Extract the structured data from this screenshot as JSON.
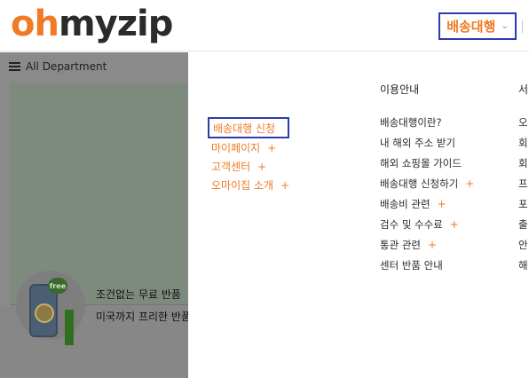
{
  "header": {
    "logo_oh": "oh",
    "logo_rest": "myzip",
    "service_label": "배송대행",
    "service_chevron": "⌄"
  },
  "left": {
    "dept_label": "All Department",
    "promo": {
      "tag": "free",
      "title": "조건없는 무료 반품",
      "subtitle": "미국까지 프리한 반품"
    }
  },
  "menu": {
    "sub_items": [
      {
        "label": "배송대행 신청",
        "plus": ""
      },
      {
        "label": "마이페이지",
        "plus": "+"
      },
      {
        "label": "고객센터",
        "plus": "+"
      },
      {
        "label": "오마이집 소개",
        "plus": "+"
      }
    ],
    "columns": [
      {
        "heading": "이용안내",
        "links": [
          {
            "label": "배송대행이란?",
            "plus": ""
          },
          {
            "label": "내 해외 주소 받기",
            "plus": ""
          },
          {
            "label": "해외 쇼핑몰 가이드",
            "plus": ""
          },
          {
            "label": "배송대행 신청하기",
            "plus": "+"
          },
          {
            "label": "배송비 관련",
            "plus": "+"
          },
          {
            "label": "검수 및 수수료",
            "plus": "+"
          },
          {
            "label": "통관 관련",
            "plus": "+"
          },
          {
            "label": "센터 반품 안내",
            "plus": ""
          }
        ]
      },
      {
        "heading": "서",
        "links": [
          {
            "label": "오"
          },
          {
            "label": "회"
          },
          {
            "label": "회"
          },
          {
            "label": "프"
          },
          {
            "label": "포"
          },
          {
            "label": "출"
          },
          {
            "label": "안"
          },
          {
            "label": "해"
          }
        ]
      }
    ]
  },
  "colors": {
    "brand_orange": "#ef7a22",
    "highlight_border": "#2b3bb0",
    "overlay_grey": "#8a8a8a"
  }
}
